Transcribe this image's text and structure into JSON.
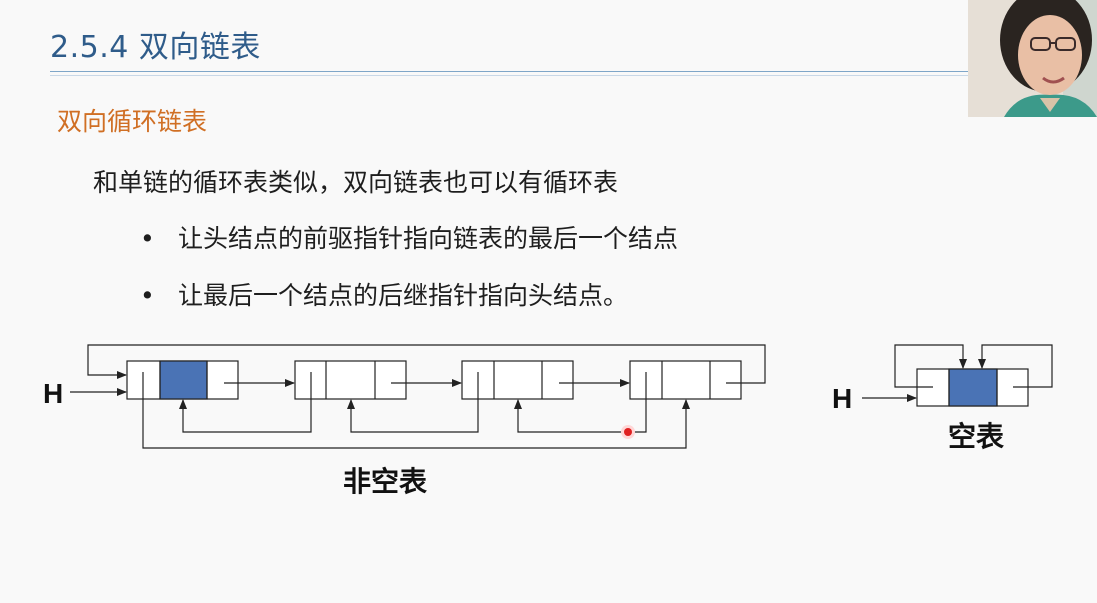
{
  "slide": {
    "title": "2.5.4 双向链表",
    "subtitle": "双向循环链表",
    "intro": "和单链的循环表类似，双向链表也可以有循环表",
    "bullets": [
      {
        "marker": "•",
        "text": "让头结点的前驱指针指向链表的最后一个结点"
      },
      {
        "marker": "•",
        "text": "让最后一个结点的后继指针指向头结点。"
      }
    ]
  },
  "diagram": {
    "nonempty": {
      "head_label": "H",
      "caption": "非空表"
    },
    "empty": {
      "head_label": "H",
      "caption": "空表"
    },
    "colors": {
      "head_data_fill": "#4a73b5",
      "line": "#222222",
      "laser": "#e02020"
    }
  },
  "webcam": {
    "description": "presenter"
  }
}
